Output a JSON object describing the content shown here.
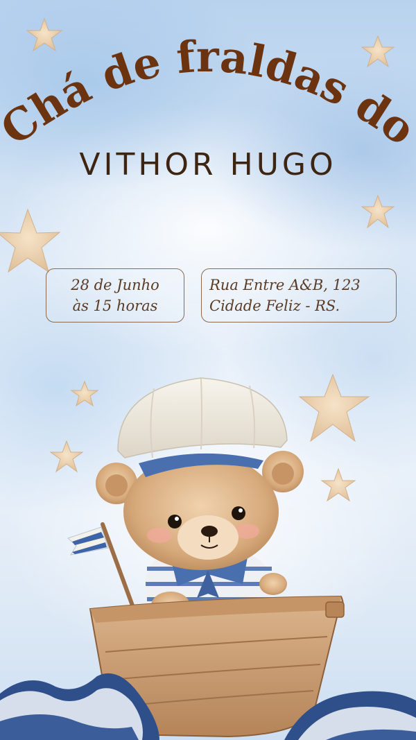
{
  "invite": {
    "title": "Chá de fraldas do",
    "name": "VITHOR HUGO",
    "date_line1": "28 de Junho",
    "date_line2": "às 15 horas",
    "address_line1": "Rua Entre A&B, 123",
    "address_line2": "Cidade Feliz - RS."
  },
  "colors": {
    "title": "#6b3310",
    "text": "#5a3b25",
    "sky": "#b8d2ee",
    "star": "#ecd3b3"
  },
  "illustration": {
    "subject": "teddy-bear-sailor-in-boat",
    "icons": [
      "star-icon",
      "flag-icon",
      "wave-icon"
    ]
  }
}
